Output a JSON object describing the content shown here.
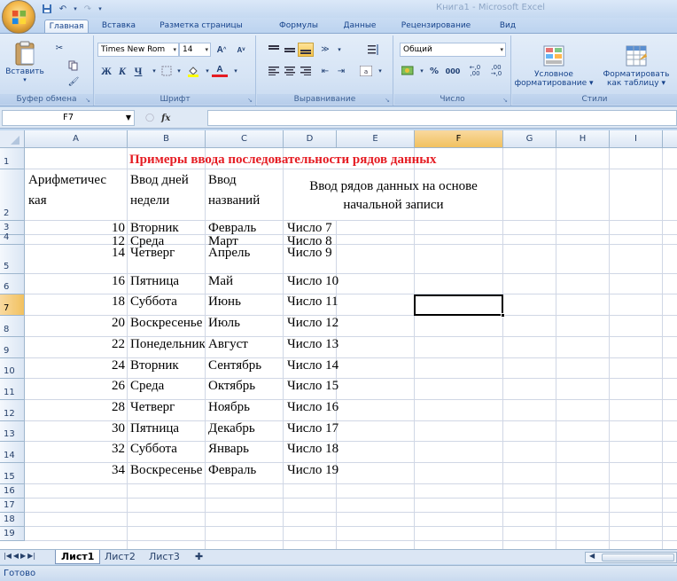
{
  "window": {
    "title": "Книга1 - Microsoft Excel"
  },
  "tabs": [
    "Главная",
    "Вставка",
    "Разметка страницы",
    "Формулы",
    "Данные",
    "Рецензирование",
    "Вид"
  ],
  "ribbon": {
    "clipboard": {
      "label": "Буфер обмена",
      "paste": "Вставить"
    },
    "font": {
      "label": "Шрифт",
      "name": "Times New Rom",
      "size": "14",
      "bold": "Ж",
      "italic": "К",
      "underline": "Ч",
      "grow": "A",
      "shrink": "A"
    },
    "alignment": {
      "label": "Выравнивание"
    },
    "number": {
      "label": "Число",
      "format": "Общий",
      "percent": "%",
      "thousands": "000",
      "inc_decimal": "←,0 ,00",
      "dec_decimal": ",00 →,0"
    },
    "styles": {
      "label": "Стили",
      "conditional": "Условное форматирование",
      "conditional_l1": "Условное",
      "conditional_l2": "форматирование",
      "as_table_l1": "Форматировать",
      "as_table_l2": "как таблицу"
    }
  },
  "formula_bar": {
    "name_box": "F7",
    "fx": "fx",
    "value": ""
  },
  "grid": {
    "columns": [
      "A",
      "B",
      "C",
      "D",
      "E",
      "F",
      "G",
      "H",
      "I"
    ],
    "selected_column": "F",
    "selected_row": "7",
    "rows": [
      "1",
      "2",
      "3",
      "4",
      "5",
      "6",
      "7",
      "8",
      "9",
      "10",
      "11",
      "12",
      "13",
      "14",
      "15",
      "16",
      "17",
      "18",
      "19"
    ],
    "title": "Примеры ввода последовательности рядов данных",
    "headers": {
      "a_l1": "Арифметичес",
      "a_l2": "кая",
      "b_l1": "Ввод дней",
      "b_l2": "недели",
      "c_l1": "Ввод",
      "c_l2": "названий",
      "de_l1": "Ввод рядов данных на основе",
      "de_l2": "начальной записи"
    },
    "data": [
      {
        "a": "10",
        "b": "Вторник",
        "c": "Февраль",
        "d": "Число 7"
      },
      {
        "a": "12",
        "b": "Среда",
        "c": "Март",
        "d": "Число 8"
      },
      {
        "a": "14",
        "b": "Четверг",
        "c": "Апрель",
        "d": "Число 9"
      },
      {
        "a": "16",
        "b": "Пятница",
        "c": "Май",
        "d": "Число 10"
      },
      {
        "a": "18",
        "b": "Суббота",
        "c": "Июнь",
        "d": "Число 11"
      },
      {
        "a": "20",
        "b": "Воскресенье",
        "c": "Июль",
        "d": "Число 12"
      },
      {
        "a": "22",
        "b": "Понедельник",
        "c": "Август",
        "d": "Число 13"
      },
      {
        "a": "24",
        "b": "Вторник",
        "c": "Сентябрь",
        "d": "Число 14"
      },
      {
        "a": "26",
        "b": "Среда",
        "c": "Октябрь",
        "d": "Число 15"
      },
      {
        "a": "28",
        "b": "Четверг",
        "c": "Ноябрь",
        "d": "Число 16"
      },
      {
        "a": "30",
        "b": "Пятница",
        "c": "Декабрь",
        "d": "Число 17"
      },
      {
        "a": "32",
        "b": "Суббота",
        "c": "Январь",
        "d": "Число 18"
      },
      {
        "a": "34",
        "b": "Воскресенье",
        "c": "Февраль",
        "d": "Число 19"
      }
    ]
  },
  "sheets": [
    "Лист1",
    "Лист2",
    "Лист3"
  ],
  "status": "Готово"
}
